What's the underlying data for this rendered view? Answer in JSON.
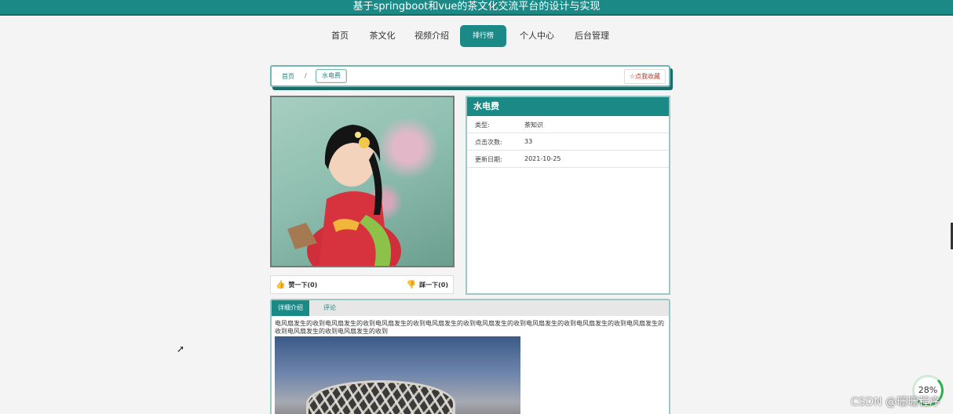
{
  "app": {
    "title": "基于springboot和vue的茶文化交流平台的设计与实现"
  },
  "nav": {
    "items": [
      {
        "label": "首页"
      },
      {
        "label": "茶文化"
      },
      {
        "label": "视频介绍"
      },
      {
        "label": "排行榜",
        "active": true
      },
      {
        "label": "个人中心"
      },
      {
        "label": "后台管理"
      }
    ]
  },
  "breadcrumb": {
    "home": "首页",
    "separator": "/",
    "current": "水电费"
  },
  "favorite_button": {
    "label": "☆点我收藏"
  },
  "vote": {
    "up_label": "赞一下(0)",
    "down_label": "踩一下(0)"
  },
  "info": {
    "title": "水电费",
    "rows": [
      {
        "key": "类型:",
        "value": "茶知识"
      },
      {
        "key": "点击次数:",
        "value": "33"
      },
      {
        "key": "更新日期:",
        "value": "2021-10-25"
      }
    ]
  },
  "detail": {
    "tabs": [
      {
        "label": "详细介绍"
      },
      {
        "label": "评论"
      }
    ],
    "description": "电风扇发生的收到电风扇发生的收到电风扇发生的收到电风扇发生的收到电风扇发生的收到电风扇发生的收到电风扇发生的收到电风扇发生的收到电风扇发生的收到电风扇发生的收到"
  },
  "overlay": {
    "progress_badge": "28%",
    "watermark": "CSDN @珊珊程序"
  },
  "colors": {
    "accent": "#1b8a86",
    "like": "#c0392b"
  }
}
